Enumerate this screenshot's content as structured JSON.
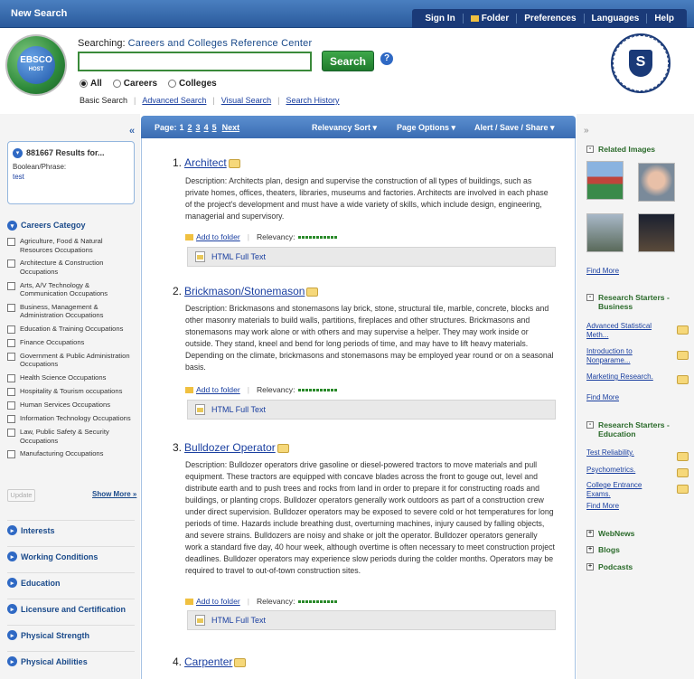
{
  "topbar": {
    "new_search": "New Search",
    "links": [
      "Sign In",
      "Folder",
      "Preferences",
      "Languages",
      "Help"
    ]
  },
  "header": {
    "searching_label": "Searching:",
    "database": "Careers and Colleges Reference Center",
    "search_value": "",
    "search_button": "Search",
    "help": "?",
    "logo": {
      "line1": "EBSCO",
      "line2": "HOST"
    },
    "seal": "S",
    "radios": [
      {
        "label": "All",
        "selected": true
      },
      {
        "label": "Careers",
        "selected": false
      },
      {
        "label": "Colleges",
        "selected": false
      }
    ],
    "modes": [
      "Basic Search",
      "Advanced Search",
      "Visual Search",
      "Search History"
    ]
  },
  "left": {
    "collapse": "«",
    "results_count": "881667 Results for...",
    "boolean_label": "Boolean/Phrase:",
    "query": "test",
    "category_title": "Careers Categoy",
    "categories": [
      "Agriculture, Food & Natural Resources Occupations",
      "Architecture & Construction Occupations",
      "Arts, A/V Technology & Communication Occupations",
      "Business, Management & Administration Occupations",
      "Education & Training Occupations",
      "Finance Occupations",
      "Government & Public Administration Occupations",
      "Health Science Occupations",
      "Hospitality & Tourism occupations",
      "Human Services Occupations",
      "Information Technology Occupations",
      "Law, Public Safety & Security Occupations",
      "Manufacturing Occupations"
    ],
    "update": "Update",
    "show_more": "Show More »",
    "sections": [
      "Interests",
      "Working Conditions",
      "Education",
      "Licensure and Certification",
      "Physical Strength",
      "Physical Abilities"
    ]
  },
  "toolbar": {
    "page_label": "Page:",
    "pages": [
      "1",
      "2",
      "3",
      "4",
      "5"
    ],
    "next": "Next",
    "sort": "Relevancy Sort ▾",
    "options": "Page Options ▾",
    "alert": "Alert / Save / Share ▾"
  },
  "results": [
    {
      "num": "1.",
      "title": "Architect",
      "desc": "Description: Architects plan, design and supervise the construction of all types of buildings, such as private homes, offices, theaters, libraries, museums and factories. Architects are involved in each phase of the project's development and must have a wide variety of skills, which include design, engineering, managerial and supervisory.",
      "add": "Add to folder",
      "relevancy": "Relevancy:",
      "fulltext": "HTML Full Text"
    },
    {
      "num": "2.",
      "title": "Brickmason/Stonemason",
      "desc": "Description: Brickmasons and stonemasons lay brick, stone, structural tile, marble, concrete, blocks and other masonry materials to build walls, partitions, fireplaces and other structures. Brickmasons and stonemasons may work alone or with others and may supervise a helper. They may work inside or outside. They stand, kneel and bend for long periods of time, and may have to lift heavy materials. Depending on the climate, brickmasons and stonemasons may be employed year round or on a seasonal basis.",
      "add": "Add to folder",
      "relevancy": "Relevancy:",
      "fulltext": "HTML Full Text"
    },
    {
      "num": "3.",
      "title": "Bulldozer Operator",
      "desc": "Description: Bulldozer operators drive gasoline or diesel-powered tractors to move materials and pull equipment. These tractors are equipped with concave blades across the front to gouge out, level and distribute earth and to push trees and rocks from land in order to prepare it for constructing roads and buildings, or planting crops. Bulldozer operators generally work outdoors as part of a construction crew under direct supervision. Bulldozer operators may be exposed to severe cold or hot temperatures for long periods of time. Hazards include breathing dust, overturning machines, injury caused by falling objects, and severe strains. Bulldozers are noisy and shake or jolt the operator. Bulldozer operators generally work a standard five day, 40 hour week, although overtime is often necessary to meet construction project deadlines. Bulldozer operators may experience slow periods during the colder months. Operators may be required to travel to out-of-town construction sites.",
      "add": "Add to folder",
      "relevancy": "Relevancy:",
      "fulltext": "HTML Full Text"
    },
    {
      "num": "4.",
      "title": "Carpenter"
    }
  ],
  "right": {
    "collapse": "»",
    "images_title": "Related Images",
    "find_more": "Find More",
    "business_title": "Research Starters - Business",
    "business_links": [
      "Advanced Statistical Meth...",
      "Introduction to Nonparame...",
      "Marketing Research."
    ],
    "education_title": "Research Starters - Education",
    "education_links": [
      "Test Reliability.",
      "Psychometrics.",
      "College Entrance Exams."
    ],
    "collapsed": [
      "WebNews",
      "Blogs",
      "Podcasts"
    ]
  }
}
